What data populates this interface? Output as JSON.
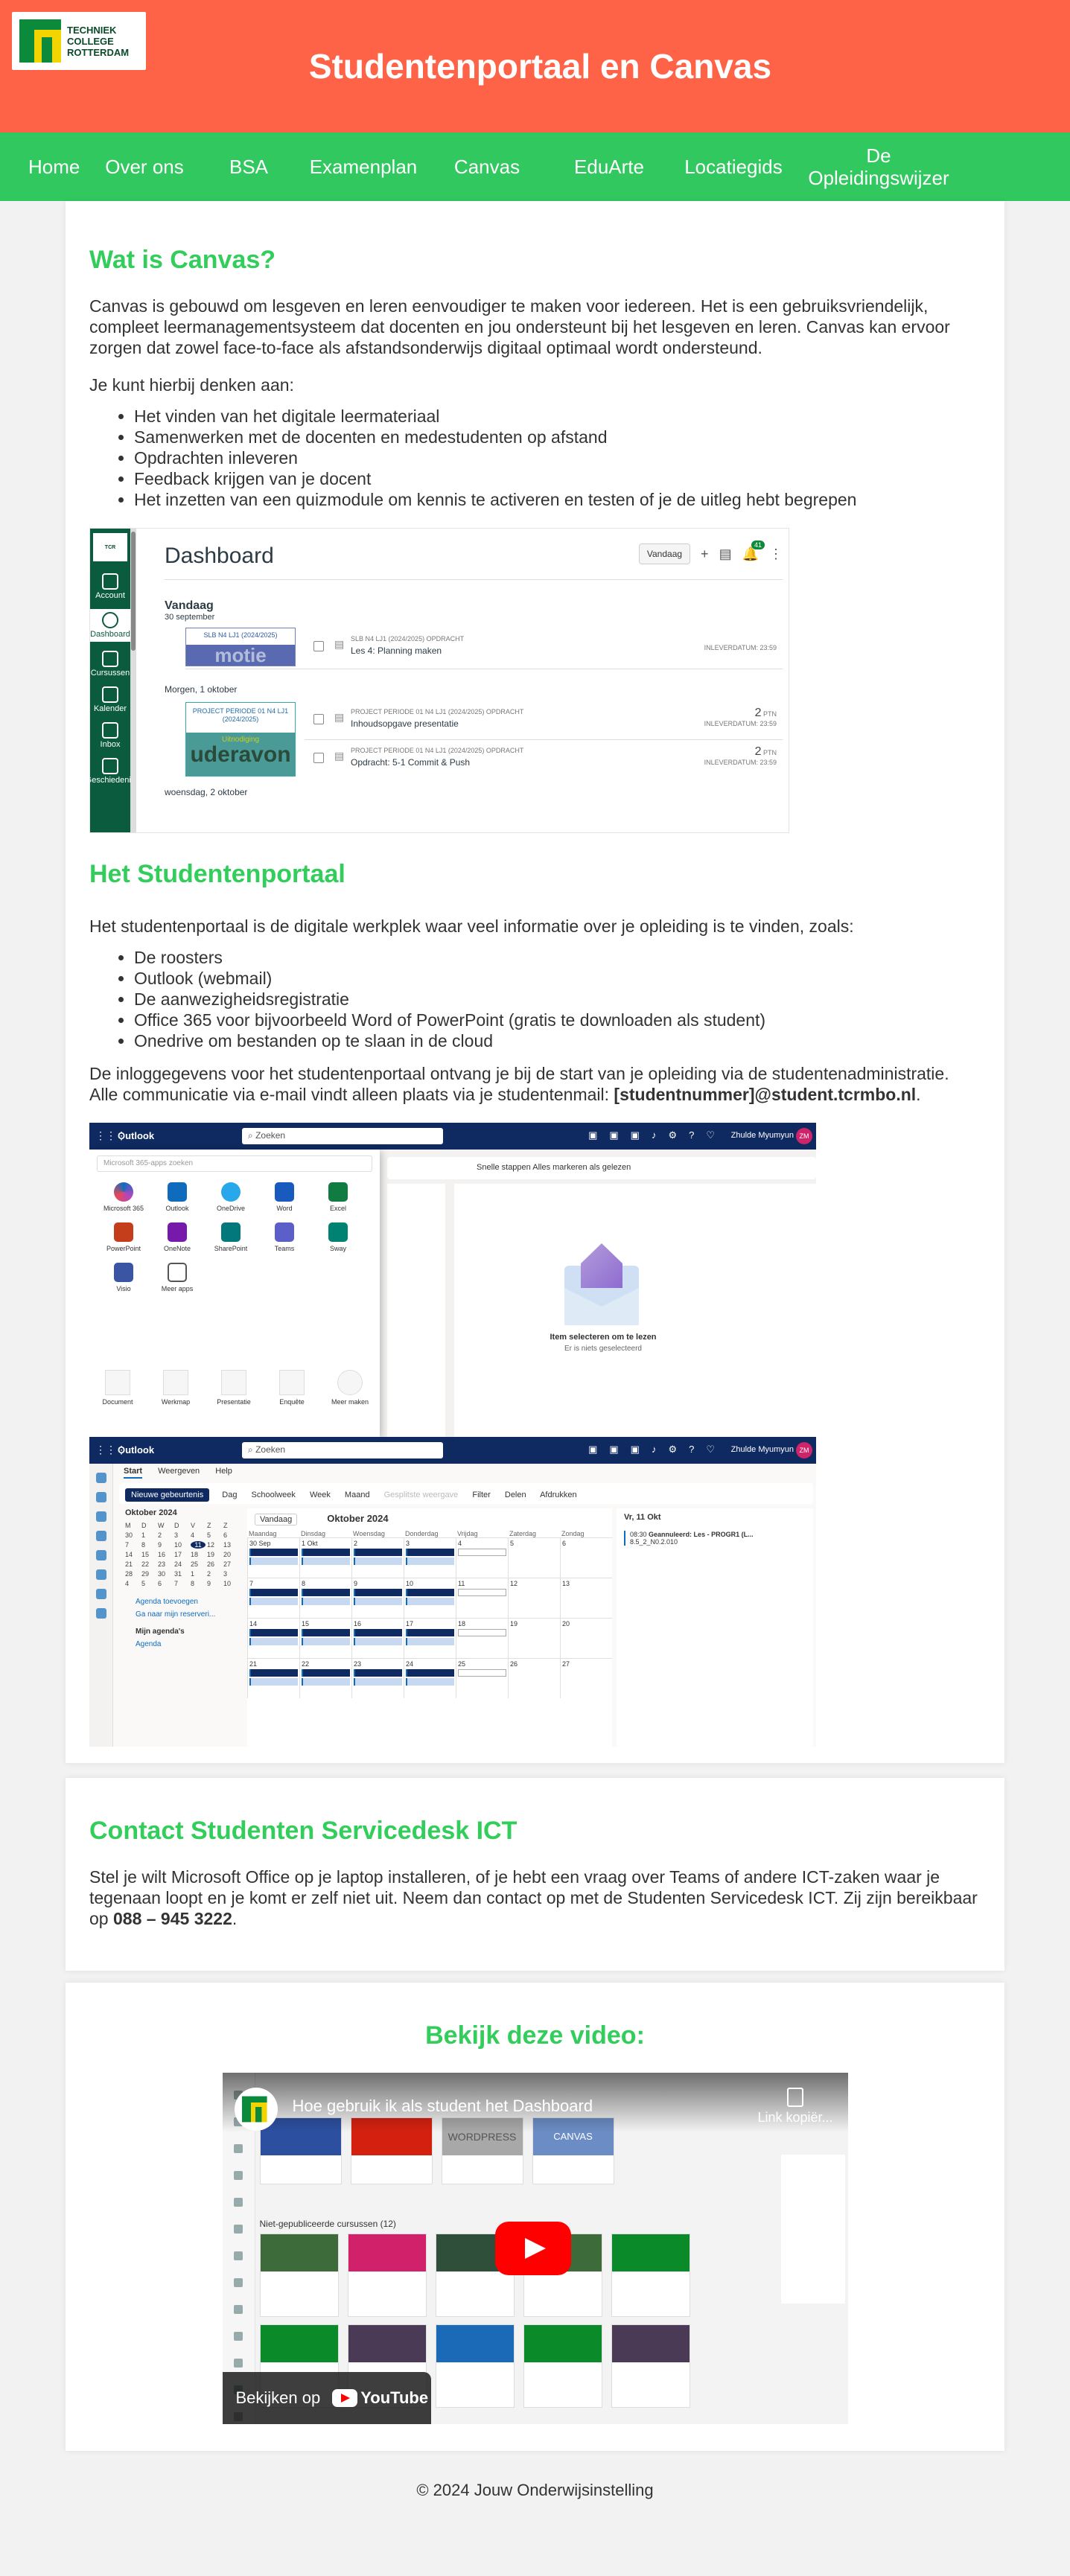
{
  "header": {
    "logo_text": [
      "TECHNIEK",
      "COLLEGE",
      "ROTTERDAM"
    ],
    "title": "Studentenportaal en Canvas",
    "bg_color": "#ff6347"
  },
  "nav": {
    "bg_color": "#32c860",
    "items": [
      "Home",
      "Over ons",
      "BSA",
      "Examenplan",
      "Canvas",
      "EduArte",
      "Locatiegids",
      "De Opleidingswijzer"
    ]
  },
  "canvas_section": {
    "heading": "Wat is Canvas?",
    "intro": "Canvas is gebouwd om lesgeven en leren eenvoudiger te maken voor iedereen. Het is een gebruiksvriendelijk, compleet leermanagementsysteem dat docenten en jou ondersteunt bij het lesgeven en leren. Canvas kan ervoor zorgen dat zowel face-to-face als afstandsonderwijs digitaal optimaal wordt ondersteund.",
    "lead": "Je kunt hierbij denken aan:",
    "bullets": [
      "Het vinden van het digitale leermateriaal",
      "Samenwerken met de docenten en medestudenten op afstand",
      "Opdrachten inleveren",
      "Feedback krijgen van je docent",
      "Het inzetten van een quizmodule om kennis te activeren en testen of je de uitleg hebt begrepen"
    ]
  },
  "dashboard_shot": {
    "title": "Dashboard",
    "sidebar": [
      "Account",
      "Dashboard",
      "Cursussen",
      "Kalender",
      "Inbox",
      "Geschiedenis"
    ],
    "view_button": "Vandaag",
    "badge": "41",
    "today": "Vandaag",
    "today_date": "30 september",
    "card1_course": "SLB N4 LJ1 (2024/2025)",
    "card1_band": "motie",
    "card1_sub": "SLB N4 LJ1 (2024/2025) OPDRACHT",
    "card1_name": "Les 4: Planning maken",
    "card1_due": "INLEVERDATUM: 23:59",
    "tomorrow": "Morgen, 1 oktober",
    "card2_course": "PROJECT PERIODE 01 N4 LJ1 (2024/2025)",
    "card2_band_a": "Uitnodiging",
    "card2_band_b": "uderavon",
    "card2_sub1": "PROJECT PERIODE 01 N4 LJ1 (2024/2025) OPDRACHT",
    "card2_name1": "Inhoudsopgave presentatie",
    "card2_sub2": "PROJECT PERIODE 01 N4 LJ1 (2024/2025) OPDRACHT",
    "card2_name2": "Opdracht: 5-1 Commit & Push",
    "pts": "2",
    "pts_unit": "PTN",
    "due": "INLEVERDATUM: 23:59",
    "next_day": "woensdag, 2 oktober"
  },
  "portal_section": {
    "heading": "Het Studentenportaal",
    "intro": "Het studentenportaal is de digitale werkplek waar veel informatie over je opleiding is te vinden, zoals:",
    "bullets": [
      "De roosters",
      "Outlook (webmail)",
      "De aanwezigheidsregistratie",
      "Office 365 voor bijvoorbeeld Word of PowerPoint (gratis te downloaden als student)",
      "Onedrive om bestanden op te slaan in de cloud"
    ],
    "login_text": "De inloggegevens voor het studentenportaal ontvang je bij de start van je opleiding via de studentenadministratie. Alle communicatie via e-mail vindt alleen plaats via je studentenmail:",
    "login_email": "[studentnummer]@student.tcrmbo.nl",
    "login_end": "."
  },
  "outlook_shot": {
    "brand": "Outlook",
    "search": "Zoeken",
    "user": "Zhulde Myumyun",
    "initials": "ZM",
    "launcher_search": "Microsoft 365-apps zoeken",
    "apps": [
      "Microsoft 365",
      "Outlook",
      "OneDrive",
      "Word",
      "Excel",
      "PowerPoint",
      "OneNote",
      "SharePoint",
      "Teams",
      "Sway",
      "Visio",
      "Meer apps"
    ],
    "files": [
      "Document",
      "Werkmap",
      "Presentatie",
      "Enquête",
      "Meer maken"
    ],
    "toolbar": "Snelle stappen   Alles markeren als gelezen",
    "empty_1": "Item selecteren om te lezen",
    "empty_2": "Er is niets geselecteerd",
    "tabs": [
      "Start",
      "Weergeven",
      "Help"
    ],
    "new_event": "Nieuwe gebeurtenis",
    "cmds": [
      "Dag",
      "Schoolweek",
      "Week",
      "Maand",
      "Gesplitste weergave",
      "Filter",
      "Delen",
      "Afdrukken"
    ],
    "mini_title": "Oktober 2024",
    "mini_days": [
      "M",
      "D",
      "W",
      "D",
      "V",
      "Z",
      "Z",
      "30",
      "1",
      "2",
      "3",
      "4",
      "5",
      "6",
      "7",
      "8",
      "9",
      "10",
      "11",
      "12",
      "13",
      "14",
      "15",
      "16",
      "17",
      "18",
      "19",
      "20",
      "21",
      "22",
      "23",
      "24",
      "25",
      "26",
      "27",
      "28",
      "29",
      "30",
      "31",
      "1",
      "2",
      "3",
      "4",
      "5",
      "6",
      "7",
      "8",
      "9",
      "10"
    ],
    "mini_highlight": "11",
    "links": [
      "Agenda toevoegen",
      "Ga naar mijn reserveri..."
    ],
    "my_cal": "Mijn agenda's",
    "cal_item": "Agenda",
    "grid_today": "Vandaag",
    "grid_title": "Oktober 2024",
    "weekdays": [
      "Maandag",
      "Dinsdag",
      "Woensdag",
      "Donderdag",
      "Vrijdag",
      "Zaterdag",
      "Zondag"
    ],
    "weeks": [
      [
        "30 Sep",
        "1 Okt",
        "2",
        "3",
        "4",
        "5",
        "6"
      ],
      [
        "7",
        "8",
        "9",
        "10",
        "11",
        "12",
        "13"
      ],
      [
        "14",
        "15",
        "16",
        "17",
        "18",
        "19",
        "20"
      ],
      [
        "21",
        "22",
        "23",
        "24",
        "25",
        "26",
        "27"
      ]
    ],
    "right_title": "Vr, 11 Okt",
    "right_time": "08:30",
    "right_event": "Geannuleerd: Les - PROGR1 (L...",
    "right_room": "8.5_2_N0.2.010"
  },
  "contact_section": {
    "heading": "Contact Studenten Servicedesk ICT",
    "text": "Stel je wilt Microsoft Office op je laptop installeren, of je hebt een vraag over Teams of andere ICT-zaken waar je tegenaan loopt en je komt er zelf niet uit. Neem dan contact op met de Studenten Servicedesk ICT. Zij zijn bereikbaar op",
    "phone": "088 – 945 3222",
    "end": "."
  },
  "video_section": {
    "heading": "Bekijk deze video:",
    "video_title": "Hoe gebruik ik als student het Dashboard",
    "copy_link": "Link kopiër...",
    "watch_on": "Bekijken op",
    "youtube": "YouTube",
    "section_label": "Niet-gepubliceerde cursussen (12)",
    "wordpress": "WORDPRESS",
    "canvas": "CANVAS"
  },
  "footer": {
    "text": "© 2024 Jouw Onderwijsinstelling"
  }
}
